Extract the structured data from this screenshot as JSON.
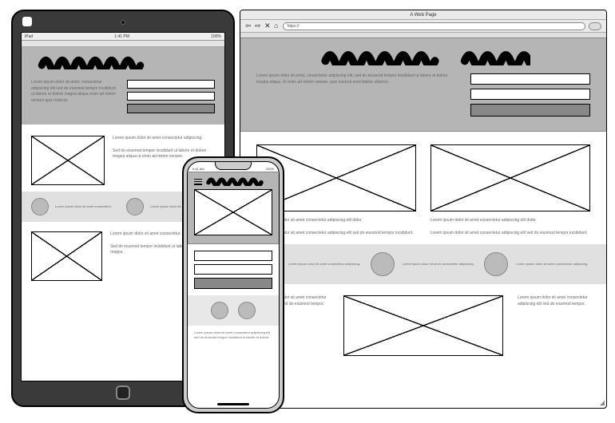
{
  "tablet": {
    "status_left": "iPad",
    "status_center": "1:41 PM",
    "status_right": "100%",
    "hero_text": "Lorem ipsum dolor sit amet, consectetur adipiscing elit sed do eiusmod tempor incididunt ut labore et dolore magna aliqua enim ad minim veniam quis nostrud.",
    "section1_text": "Lorem ipsum dolor sit amet consectetur adipiscing.",
    "section1_text2": "Sed do eiusmod tempor incididunt ut labore et dolore magna aliqua ut enim ad minim veniam.",
    "band_text1": "Lorem ipsum dolor sit amet consectetur.",
    "band_text2": "Lorem ipsum dolor sit amet consectetur.",
    "section2_text1": "Lorem ipsum dolor sit amet consectetur.",
    "section2_text2": "Sed do eiusmod tempor incididunt ut labore et dolore magna."
  },
  "browser": {
    "title": "A Web Page",
    "url_value": "https://",
    "hero_text": "Lorem ipsum dolor sit amet, consectetur adipiscing elit, sed do eiusmod tempor incididunt ut labore et dolore magna aliqua. Ut enim ad minim veniam, quis nostrud exercitation ullamco.",
    "col1_text": "Lorem ipsum dolor sit amet consectetur adipiscing elit dolor.",
    "col1_text2": "Lorem ipsum dolor sit amet consectetur adipiscing elit sed do eiusmod tempor incididunt.",
    "col2_text": "Lorem ipsum dolor sit amet consectetur adipiscing elit dolor.",
    "col2_text2": "Lorem ipsum dolor sit amet consectetur adipiscing elit sed do eiusmod tempor incididunt.",
    "band_text1": "Lorem ipsum dolor sit amet consectetur adipiscing.",
    "band_text2": "Lorem ipsum dolor sit amet consectetur adipiscing.",
    "band_text3": "Lorem ipsum dolor sit amet consectetur adipiscing.",
    "below_text1": "Lorem ipsum dolor sit amet consectetur adipiscing elit sed do eiusmod tempor.",
    "below_text2": "Lorem ipsum dolor sit amet consectetur adipiscing elit sed do eiusmod tempor."
  },
  "phone": {
    "status_left": "9:41 AM",
    "status_right": "100%",
    "foot_text": "Lorem ipsum dolor sit amet consectetur adipiscing elit sed do eiusmod tempor incididunt ut labore et dolore."
  }
}
